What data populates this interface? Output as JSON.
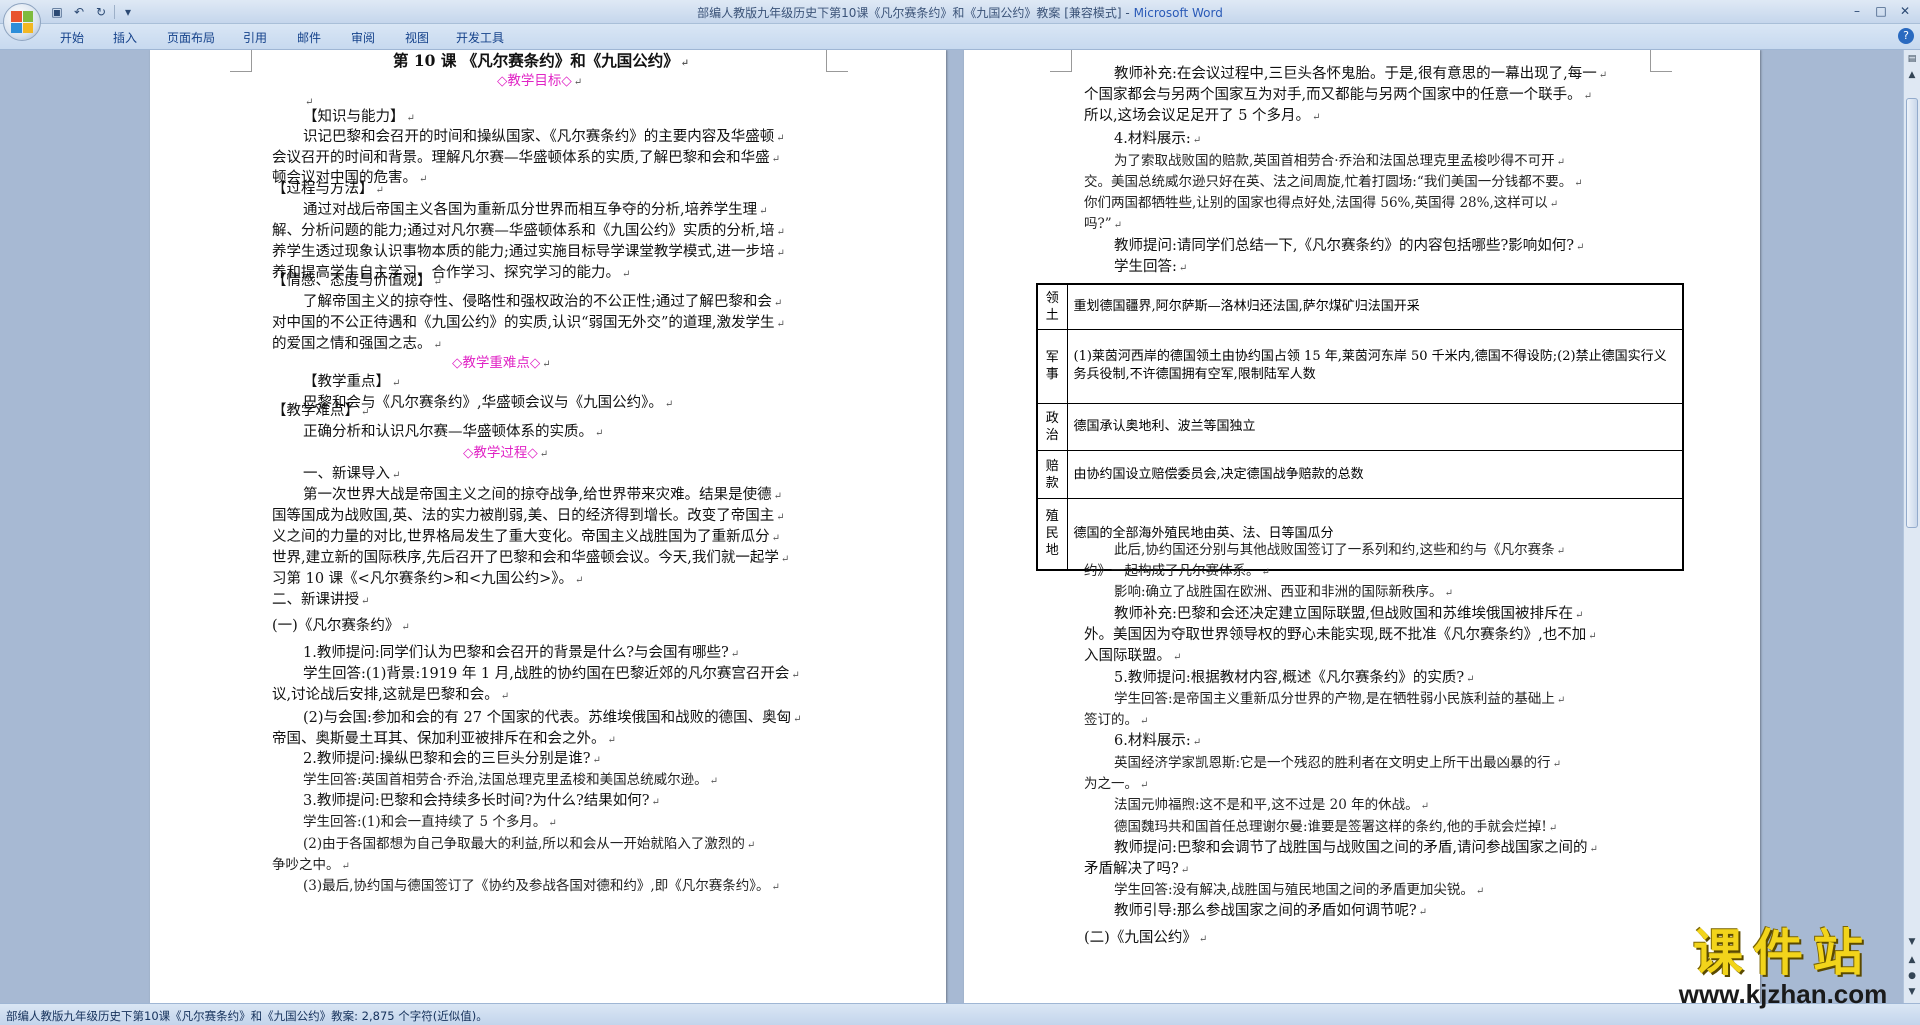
{
  "window": {
    "title": "部编人教版九年级历史下第10课《凡尔赛条约》和《九国公约》教案 [兼容模式] - ",
    "app": "Microsoft Word"
  },
  "ribbon": {
    "tabs": [
      "开始",
      "插入",
      "页面布局",
      "引用",
      "邮件",
      "审阅",
      "视图",
      "开发工具"
    ]
  },
  "page1": {
    "lines": [
      {
        "t": "第 10 课  《凡尔赛条约》和《九国公约》",
        "c": "title"
      },
      {
        "t": "◇教学目标◇",
        "c": "pink"
      },
      {
        "t": "",
        "c": ""
      },
      {
        "t": "【知识与能力】",
        "c": ""
      },
      {
        "t": "识记巴黎和会召开的时间和操纵国家、《凡尔赛条约》的主要内容及华盛顿",
        "c": ""
      },
      {
        "t": "会议召开的时间和背景。理解凡尔赛—华盛顿体系的实质,了解巴黎和会和华盛",
        "c": ""
      },
      {
        "t": "顿会议对中国的危害。",
        "c": ""
      },
      {
        "t": "【过程与方法】",
        "c": ""
      },
      {
        "t": "通过对战后帝国主义各国为重新瓜分世界而相互争夺的分析,培养学生理",
        "c": ""
      },
      {
        "t": "解、分析问题的能力;通过对凡尔赛—华盛顿体系和《九国公约》实质的分析,培",
        "c": ""
      },
      {
        "t": "养学生透过现象认识事物本质的能力;通过实施目标导学课堂教学模式,进一步培",
        "c": ""
      },
      {
        "t": "养和提高学生自主学习、合作学习、探究学习的能力。",
        "c": ""
      },
      {
        "t": "【情感、态度与价值观】",
        "c": ""
      },
      {
        "t": "了解帝国主义的掠夺性、侵略性和强权政治的不公正性;通过了解巴黎和会",
        "c": ""
      },
      {
        "t": "对中国的不公正待遇和《九国公约》的实质,认识“弱国无外交”的道理,激发学生",
        "c": ""
      },
      {
        "t": "的爱国之情和强国之志。",
        "c": ""
      },
      {
        "t": "◇教学重难点◇",
        "c": "pink"
      },
      {
        "t": "【教学重点】",
        "c": ""
      },
      {
        "t": "巴黎和会与《凡尔赛条约》,华盛顿会议与《九国公约》。",
        "c": ""
      },
      {
        "t": "【教学难点】",
        "c": ""
      },
      {
        "t": "正确分析和认识凡尔赛—华盛顿体系的实质。",
        "c": ""
      },
      {
        "t": "◇教学过程◇",
        "c": "pink"
      },
      {
        "t": "一、新课导入",
        "c": ""
      },
      {
        "t": "第一次世界大战是帝国主义之间的掠夺战争,给世界带来灾难。结果是使德",
        "c": ""
      },
      {
        "t": "国等国成为战败国,英、法的实力被削弱,美、日的经济得到增长。改变了帝国主",
        "c": ""
      },
      {
        "t": "义之间的力量的对比,世界格局发生了重大变化。帝国主义战胜国为了重新瓜分",
        "c": ""
      },
      {
        "t": "世界,建立新的国际秩序,先后召开了巴黎和会和华盛顿会议。今天,我们就一起学",
        "c": ""
      },
      {
        "t": "习第 10 课《<凡尔赛条约>和<九国公约>》。",
        "c": ""
      },
      {
        "t": "二、新课讲授",
        "c": ""
      },
      {
        "t": "(一)《凡尔赛条约》",
        "c": ""
      },
      {
        "t": "1.教师提问:同学们认为巴黎和会召开的背景是什么?与会国有哪些?",
        "c": ""
      },
      {
        "t": "学生回答:(1)背景:1919 年 1 月,战胜的协约国在巴黎近郊的凡尔赛宫召开会",
        "c": ""
      },
      {
        "t": "议,讨论战后安排,这就是巴黎和会。",
        "c": ""
      },
      {
        "t": "(2)与会国:参加和会的有 27 个国家的代表。苏维埃俄国和战败的德国、奥匈",
        "c": ""
      },
      {
        "t": "帝国、奥斯曼土耳其、保加利亚被排斥在和会之外。",
        "c": ""
      },
      {
        "t": "2.教师提问:操纵巴黎和会的三巨头分别是谁?",
        "c": ""
      },
      {
        "t": "学生回答:英国首相劳合·乔治,法国总理克里孟梭和美国总统威尔逊。",
        "c": "kai"
      },
      {
        "t": "3.教师提问:巴黎和会持续多长时间?为什么?结果如何?",
        "c": ""
      },
      {
        "t": "学生回答:(1)和会一直持续了 5 个多月。",
        "c": "kai"
      },
      {
        "t": "(2)由于各国都想为自己争取最大的利益,所以和会从一开始就陷入了激烈的",
        "c": "kai"
      },
      {
        "t": "争吵之中。",
        "c": "kai"
      },
      {
        "t": "(3)最后,协约国与德国签订了《协约及参战各国对德和约》,即《凡尔赛条约》。",
        "c": "kai"
      }
    ]
  },
  "page2": {
    "lines_top": [
      {
        "t": "教师补充:在会议过程中,三巨头各怀鬼胎。于是,很有意思的一幕出现了,每一",
        "c": ""
      },
      {
        "t": "个国家都会与另两个国家互为对手,而又都能与另两个国家中的任意一个联手。",
        "c": ""
      },
      {
        "t": "所以,这场会议足足开了 5 个多月。",
        "c": ""
      },
      {
        "t": "4.材料展示:",
        "c": ""
      },
      {
        "t": "为了索取战败国的赔款,英国首相劳合·乔治和法国总理克里孟梭吵得不可开",
        "c": "kai"
      },
      {
        "t": "交。美国总统威尔逊只好在英、法之间周旋,忙着打圆场:“我们美国一分钱都不要。",
        "c": "kai"
      },
      {
        "t": "你们两国都牺牲些,让别的国家也得点好处,法国得 56%,英国得 28%,这样可以",
        "c": "kai"
      },
      {
        "t": "吗?”",
        "c": "kai"
      },
      {
        "t": "教师提问:请同学们总结一下,《凡尔赛条约》的内容包括哪些?影响如何?",
        "c": ""
      },
      {
        "t": "学生回答:",
        "c": ""
      }
    ],
    "table": [
      {
        "head": "领土",
        "body": "重划德国疆界,阿尔萨斯—洛林归还法国,萨尔煤矿归法国开采"
      },
      {
        "head": "军事",
        "body": "(1)莱茵河西岸的德国领土由协约国占领 15 年,莱茵河东岸 50 千米内,德国不得设防;(2)禁止德国实行义务兵役制,不许德国拥有空军,限制陆军人数"
      },
      {
        "head": "政治",
        "body": "德国承认奥地利、波兰等国独立"
      },
      {
        "head": "赔款",
        "body": "由协约国设立赔偿委员会,决定德国战争赔款的总数"
      },
      {
        "head": "殖民地",
        "body": "德国的全部海外殖民地由英、法、日等国瓜分"
      }
    ],
    "lines_bottom": [
      {
        "t": "此后,协约国还分别与其他战败国签订了一系列和约,这些和约与《凡尔赛条",
        "c": "kai"
      },
      {
        "t": "约》一起构成了凡尔赛体系。",
        "c": "kai"
      },
      {
        "t": "影响:确立了战胜国在欧洲、西亚和非洲的国际新秩序。",
        "c": "kai"
      },
      {
        "t": "教师补充:巴黎和会还决定建立国际联盟,但战败国和苏维埃俄国被排斥在",
        "c": ""
      },
      {
        "t": "外。美国因为夺取世界领导权的野心未能实现,既不批准《凡尔赛条约》,也不加",
        "c": ""
      },
      {
        "t": "入国际联盟。",
        "c": ""
      },
      {
        "t": "5.教师提问:根据教材内容,概述《凡尔赛条约》的实质?",
        "c": ""
      },
      {
        "t": "学生回答:是帝国主义重新瓜分世界的产物,是在牺牲弱小民族利益的基础上",
        "c": "kai"
      },
      {
        "t": "签订的。",
        "c": "kai"
      },
      {
        "t": "6.材料展示:",
        "c": ""
      },
      {
        "t": "英国经济学家凯恩斯:它是一个残忍的胜利者在文明史上所干出最凶暴的行",
        "c": "kai"
      },
      {
        "t": "为之一。",
        "c": "kai"
      },
      {
        "t": "法国元帅福煦:这不是和平,这不过是 20 年的休战。",
        "c": "kai"
      },
      {
        "t": "德国魏玛共和国首任总理谢尔曼:谁要是签署这样的条约,他的手就会烂掉!",
        "c": "kai"
      },
      {
        "t": "教师提问:巴黎和会调节了战胜国与战败国之间的矛盾,请问参战国家之间的",
        "c": ""
      },
      {
        "t": "矛盾解决了吗?",
        "c": ""
      },
      {
        "t": "学生回答:没有解决,战胜国与殖民地国之间的矛盾更加尖锐。",
        "c": "kai"
      },
      {
        "t": "教师引导:那么参战国家之间的矛盾如何调节呢?",
        "c": ""
      },
      {
        "t": "(二)《九国公约》",
        "c": ""
      }
    ]
  },
  "status": {
    "text": "部编人教版九年级历史下第10课《凡尔赛条约》和《九国公约》教案: 2,875 个字符(近似值)。"
  },
  "watermark": {
    "main": "课件站",
    "sub": "www.kjzhan.com"
  }
}
